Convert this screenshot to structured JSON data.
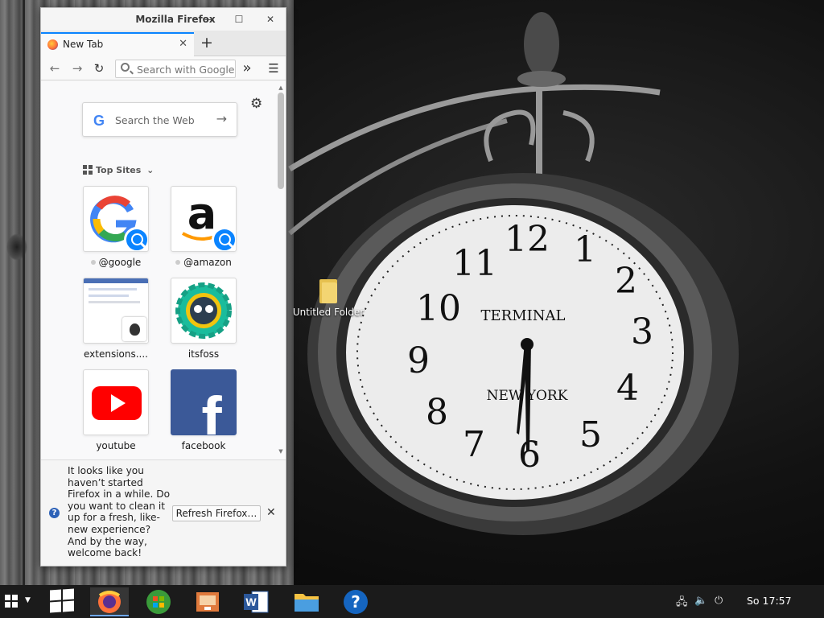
{
  "desktop": {
    "icons": [
      {
        "label": "Untitled Folder",
        "icon": "folder-icon"
      }
    ]
  },
  "firefox": {
    "window_title": "Mozilla Firefox",
    "controls": {
      "minimize": "—",
      "maximize": "☐",
      "close": "✕"
    },
    "tab": {
      "title": "New Tab",
      "close": "✕"
    },
    "new_tab": "+",
    "nav": {
      "back": "←",
      "forward": "→",
      "reload": "↻",
      "search_placeholder": "Search with Google or enter address",
      "overflow": "»",
      "menu": "☰"
    },
    "newtab_page": {
      "settings": "⚙",
      "search_label": "Search the Web",
      "search_logo": "G",
      "search_arrow": "→",
      "top_sites_header": "Top Sites",
      "top_sites_chevron": "⌄",
      "tiles": [
        {
          "caption": "@google",
          "icon": "google-icon",
          "pinned": true
        },
        {
          "caption": "@amazon",
          "icon": "amazon-icon",
          "pinned": true
        },
        {
          "caption": "extensions....",
          "icon": "gnome-extensions-icon",
          "pinned": false
        },
        {
          "caption": "itsfoss",
          "icon": "itsfoss-icon",
          "pinned": false
        },
        {
          "caption": "youtube",
          "icon": "youtube-icon",
          "pinned": false
        },
        {
          "caption": "facebook",
          "icon": "facebook-icon",
          "pinned": false
        }
      ]
    },
    "notification": {
      "message": "It looks like you haven’t started Firefox in a while. Do you want to clean it up for a fresh, like-new experience? And by the way, welcome back!",
      "button": "Refresh Firefox…",
      "close": "✕"
    }
  },
  "taskbar": {
    "apps": [
      "firefox-icon",
      "windows-xp-icon",
      "installer-icon",
      "word-icon",
      "file-explorer-icon",
      "help-icon"
    ],
    "clock": "So 17:57",
    "colors": {
      "accent": "#0a84ff",
      "taskbar": "#1b1b1b"
    }
  }
}
